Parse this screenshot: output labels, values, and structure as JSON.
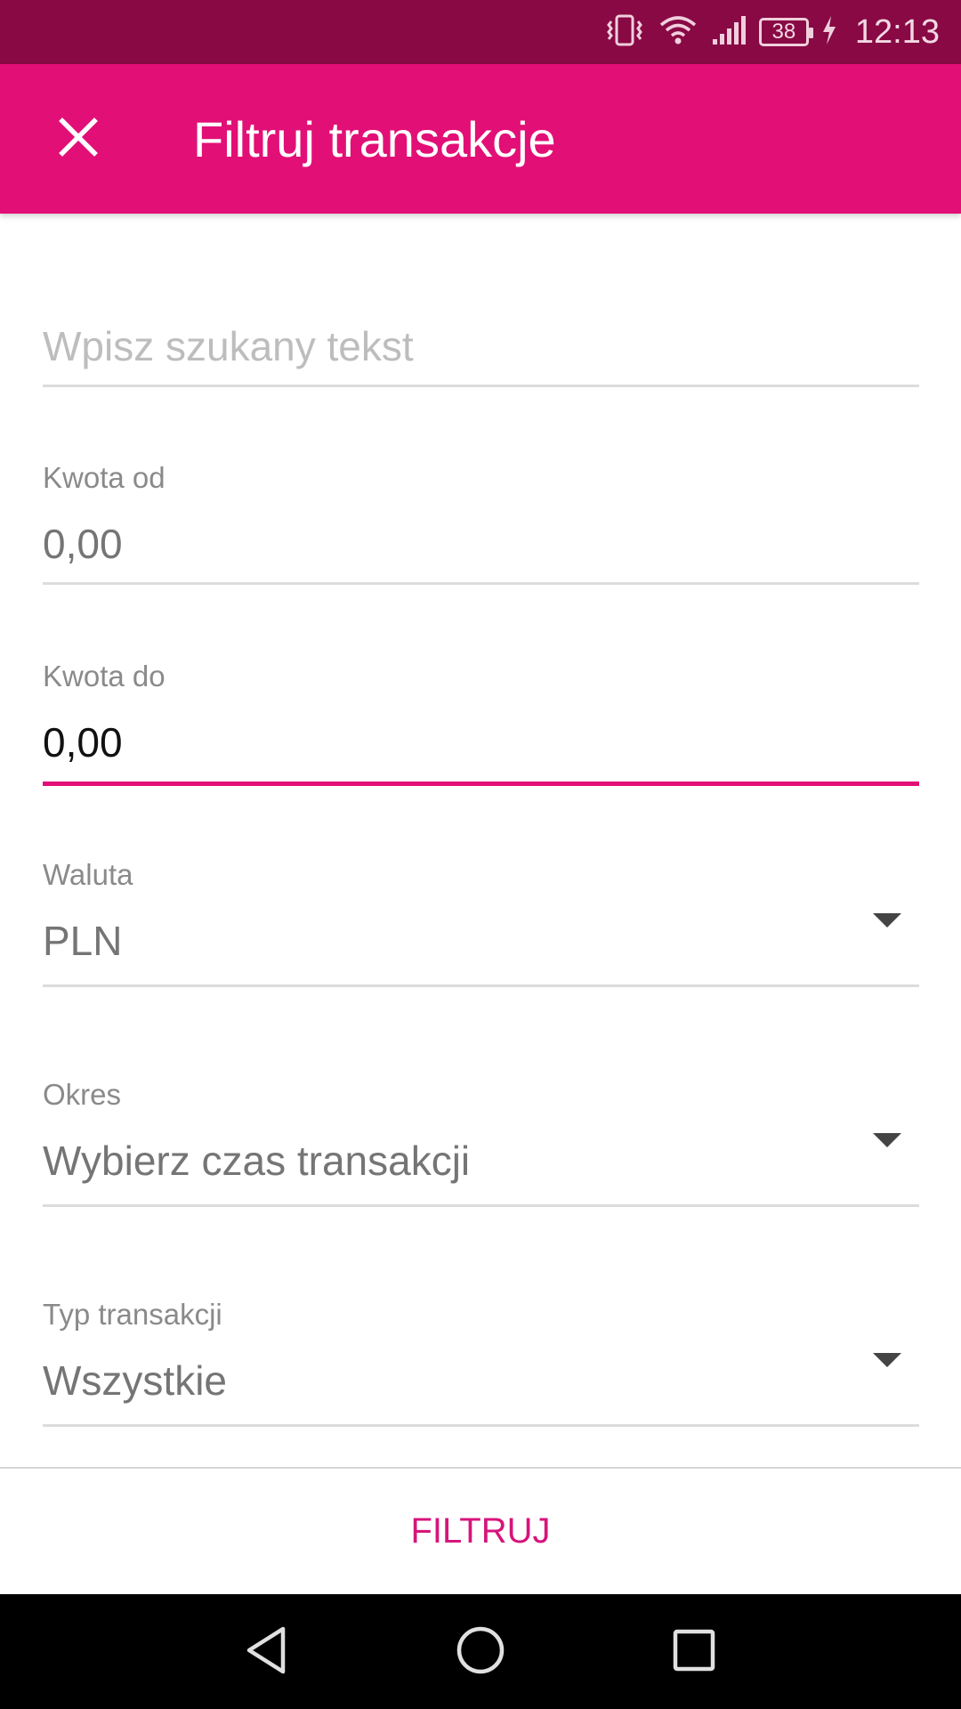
{
  "status_bar": {
    "battery_level": "38",
    "time": "12:13"
  },
  "app_bar": {
    "title": "Filtruj transakcje",
    "close_icon": "close-icon"
  },
  "form": {
    "search": {
      "placeholder": "Wpisz szukany tekst",
      "value": ""
    },
    "amount_from": {
      "label": "Kwota od",
      "value": "0,00"
    },
    "amount_to": {
      "label": "Kwota do",
      "value": "0,00"
    },
    "currency": {
      "label": "Waluta",
      "value": "PLN"
    },
    "period": {
      "label": "Okres",
      "value": "Wybierz czas transakcji"
    },
    "type": {
      "label": "Typ transakcji",
      "value": "Wszystkie"
    }
  },
  "actions": {
    "filter_label": "FILTRUJ"
  },
  "colors": {
    "status_bar": "#880944",
    "app_bar": "#e20f76",
    "accent": "#e20f76",
    "action_text": "#d6157b"
  }
}
